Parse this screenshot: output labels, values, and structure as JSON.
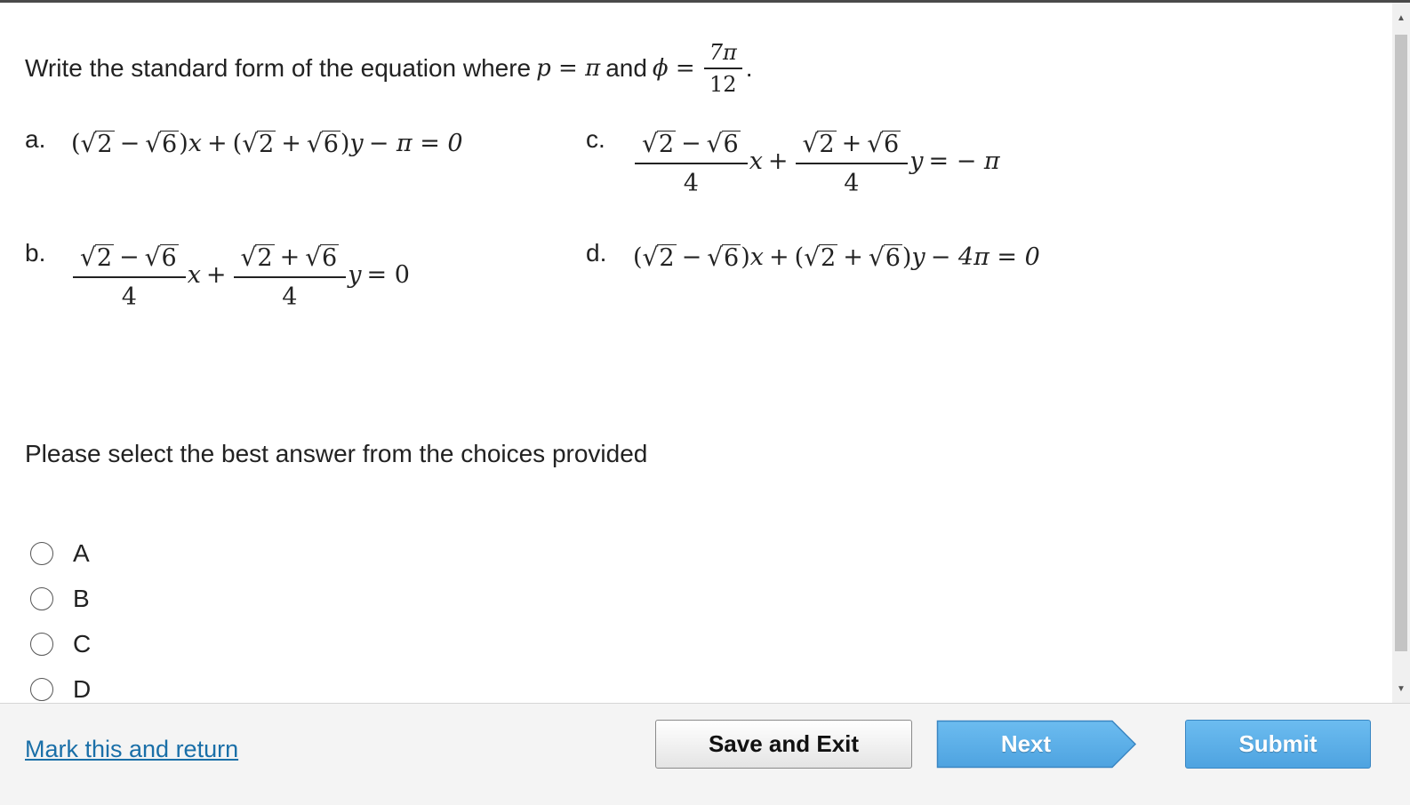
{
  "question": {
    "text": "Write the standard form of the equation where",
    "p_expr": "p = π",
    "and_text": "and",
    "phi_lhs": "ϕ =",
    "phi_num": "7π",
    "phi_den": "12",
    "period": "."
  },
  "choices": {
    "a": {
      "label": "a.",
      "expr": "(√2 − √6)x + (√2 + √6)y − π = 0"
    },
    "b": {
      "label": "b.",
      "expr": "(√2 − √6)/4 x + (√2 + √6)/4 y = 0"
    },
    "c": {
      "label": "c.",
      "expr": "(√2 − √6)/4 x + (√2 + √6)/4 y = −π"
    },
    "d": {
      "label": "d.",
      "expr": "(√2 − √6)x + (√2 + √6)y − 4π = 0"
    }
  },
  "math_parts": {
    "sqrt2": "2",
    "sqrt6": "6",
    "minus": "−",
    "plus": "+",
    "four": "4",
    "x": "x",
    "y": "y",
    "a_tail": "− π = 0",
    "b_tail": "= 0",
    "c_tail": "= − π",
    "d_tail": "− 4π = 0"
  },
  "prompt": "Please select the best answer from the choices provided",
  "options": [
    {
      "label": "A",
      "selected": false
    },
    {
      "label": "B",
      "selected": false
    },
    {
      "label": "C",
      "selected": false
    },
    {
      "label": "D",
      "selected": false
    }
  ],
  "footer": {
    "mark_link": "Mark this and return",
    "save_exit": "Save and Exit",
    "next": "Next",
    "submit": "Submit"
  },
  "colors": {
    "link": "#1a6fa8",
    "primary_button": "#5aaee6",
    "footer_bg": "#f4f4f4"
  }
}
